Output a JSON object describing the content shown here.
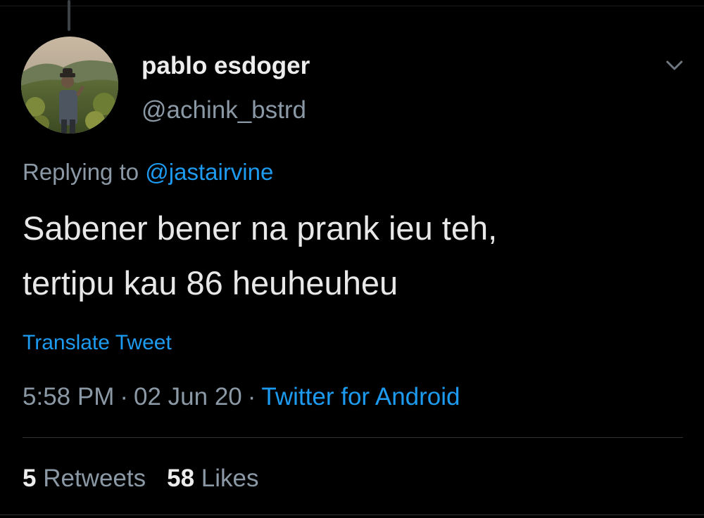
{
  "theme": {
    "background": "#000000",
    "primary_text": "#e8e8e8",
    "secondary_text": "#8b98a5",
    "accent": "#1d9bf0"
  },
  "author": {
    "display_name": "pablo esdoger",
    "handle": "@achink_bstrd",
    "avatar": "avatar-photo"
  },
  "reply": {
    "prefix": "Replying to",
    "mention": "@jastairvine"
  },
  "tweet": {
    "lines": [
      "Sabener bener na prank ieu teh,",
      "tertipu kau 86 heuheuheu"
    ],
    "translate_label": "Translate Tweet"
  },
  "meta": {
    "time": "5:58 PM",
    "separator": "·",
    "date": "02 Jun 20",
    "source": "Twitter for Android"
  },
  "stats": {
    "retweets_count": "5",
    "retweets_label": "Retweets",
    "likes_count": "58",
    "likes_label": "Likes"
  },
  "icons": {
    "menu": "chevron-down-icon"
  }
}
